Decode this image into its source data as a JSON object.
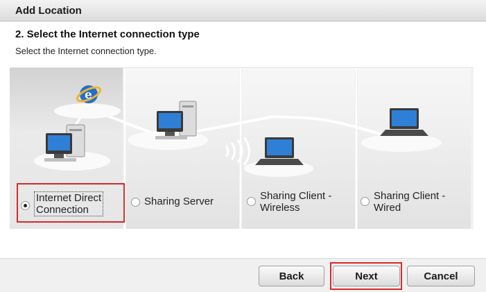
{
  "window": {
    "title": "Add Location"
  },
  "step": {
    "heading": "2. Select the Internet connection type",
    "description": "Select the Internet connection type."
  },
  "options": [
    {
      "label_line1": "Internet Direct",
      "label_line2": "Connection",
      "selected": true
    },
    {
      "label_line1": "Sharing Server",
      "label_line2": "",
      "selected": false
    },
    {
      "label_line1": "Sharing Client -",
      "label_line2": "Wireless",
      "selected": false
    },
    {
      "label_line1": "Sharing Client -",
      "label_line2": "Wired",
      "selected": false
    }
  ],
  "buttons": {
    "back": "Back",
    "next": "Next",
    "cancel": "Cancel"
  },
  "colors": {
    "highlight": "#d62a2a",
    "ie_icon": "#1f6fd1",
    "screen": "#2f7fd6"
  },
  "icons": [
    "internet-explorer-icon",
    "desktop-computer-icon",
    "laptop-icon",
    "wireless-signal-icon"
  ]
}
